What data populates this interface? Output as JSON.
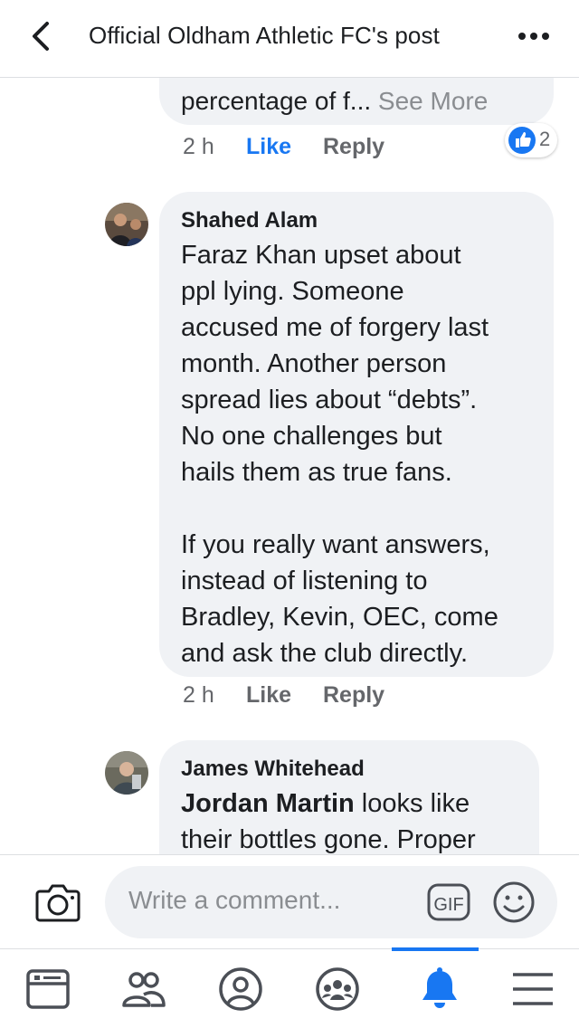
{
  "header": {
    "title": "Official Oldham Athletic FC's post"
  },
  "comments": [
    {
      "text_partial": "percentage of f...",
      "see_more": "See More",
      "time": "2 h",
      "like": "Like",
      "reply": "Reply",
      "reaction_count": "2",
      "reaction_icon": "like-reaction-icon"
    },
    {
      "author": "Shahed Alam",
      "lines": [
        "Faraz Khan upset about",
        "ppl lying. Someone",
        "accused me of forgery last",
        "month. Another person",
        "spread lies about “debts”.",
        "No one challenges but",
        "hails them as true fans.",
        "",
        "If you really want answers,",
        "instead of listening to",
        "Bradley, Kevin, OEC, come",
        "and ask the club directly."
      ],
      "time": "2 h",
      "like": "Like",
      "reply": "Reply"
    },
    {
      "author": "James Whitehead",
      "mention": "Jordan Martin",
      "line1_rest": " looks like",
      "line2": "their bottles gone. Proper"
    }
  ],
  "composer": {
    "placeholder": "Write a comment...",
    "gif_label": "GIF"
  },
  "tabs": [
    {
      "icon": "news-feed-icon"
    },
    {
      "icon": "friends-icon"
    },
    {
      "icon": "profile-icon"
    },
    {
      "icon": "groups-icon"
    },
    {
      "icon": "notifications-bell-icon",
      "active": true
    },
    {
      "icon": "menu-icon"
    }
  ],
  "colors": {
    "accent": "#1877f2",
    "bubble": "#f0f2f5",
    "muted": "#65676b"
  }
}
